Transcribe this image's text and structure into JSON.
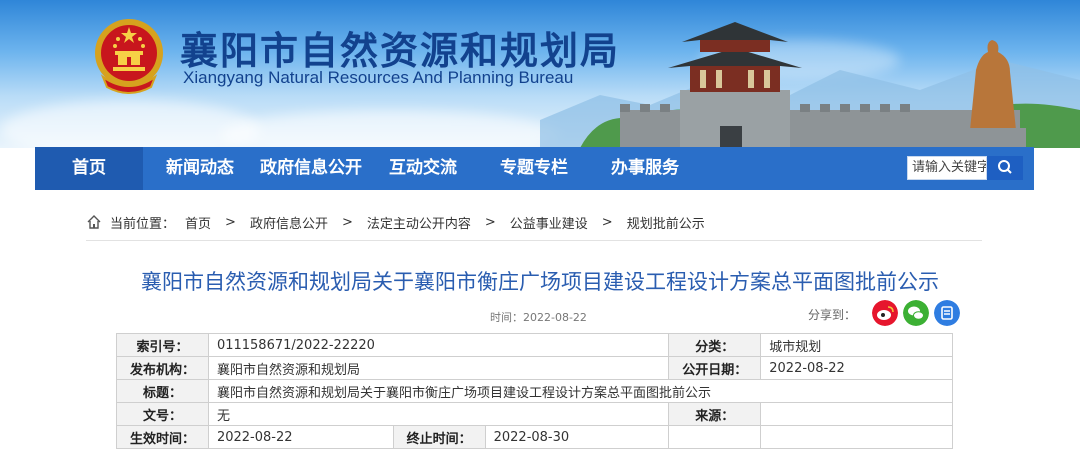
{
  "header": {
    "title_cn": "襄阳市自然资源和规划局",
    "title_en": "Xiangyang Natural Resources And Planning Bureau"
  },
  "nav": {
    "items": [
      "首页",
      "新闻动态",
      "政府信息公开",
      "互动交流",
      "专题专栏",
      "办事服务"
    ],
    "search_placeholder": "请输入关键字"
  },
  "breadcrumb": {
    "prefix": "当前位置：",
    "items": [
      "首页",
      "政府信息公开",
      "法定主动公开内容",
      "公益事业建设",
      "规划批前公示"
    ],
    "separator": ">"
  },
  "article": {
    "title": "襄阳市自然资源和规划局关于襄阳市衡庄广场项目建设工程设计方案总平面图批前公示",
    "time_label": "时间：",
    "time": "2022-08-22",
    "share_label": "分享到："
  },
  "share": {
    "icons": [
      "weibo-icon",
      "wechat-icon",
      "qzone-icon"
    ],
    "colors": [
      "#e6162d",
      "#3cb034",
      "#2f7de1"
    ]
  },
  "info": {
    "index_label": "索引号：",
    "index_value": "011158671/2022-22220",
    "category_label": "分类：",
    "category_value": "城市规划",
    "publisher_label": "发布机构：",
    "publisher_value": "襄阳市自然资源和规划局",
    "pubdate_label": "公开日期：",
    "pubdate_value": "2022-08-22",
    "subject_label": "标题：",
    "subject_value": "襄阳市自然资源和规划局关于襄阳市衡庄广场项目建设工程设计方案总平面图批前公示",
    "docno_label": "文号：",
    "docno_value": "无",
    "source_label": "来源：",
    "source_value": "",
    "effective_label": "生效时间：",
    "effective_value": "2022-08-22",
    "end_label": "终止时间：",
    "end_value": "2022-08-30"
  },
  "colors": {
    "nav_bg": "#2a6fc9",
    "title_blue": "#2a5db0",
    "header_text": "#12428e"
  }
}
